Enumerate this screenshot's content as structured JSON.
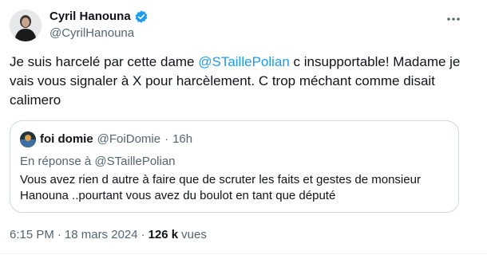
{
  "author": {
    "name": "Cyril Hanouna",
    "handle": "@CyrilHanouna"
  },
  "tweet": {
    "text_before": "Je suis harcelé par cette dame ",
    "mention": "@STaillePolian",
    "text_after": " c insupportable! Madame je vais vous signaler à X pour harcèlement. C trop méchant comme disait calimero"
  },
  "quote": {
    "name": "foi domie",
    "handle": "@FoiDomie",
    "separator": "·",
    "time": "16h",
    "reply_prefix": "En réponse à ",
    "reply_mention": "@STaillePolian",
    "text": "Vous avez rien d autre à faire que de scruter les faits et gestes de monsieur Hanouna ..pourtant vous avez du boulot en tant que député"
  },
  "meta": {
    "time": "6:15 PM",
    "separator": "·",
    "date": "18 mars 2024",
    "views_count": "126 k",
    "views_label": "vues"
  },
  "icons": {
    "verified": "verified-badge-icon",
    "more": "more-options-icon"
  },
  "colors": {
    "accent": "#1d9bf0",
    "secondary_text": "#536471",
    "border": "#cfd9de"
  }
}
